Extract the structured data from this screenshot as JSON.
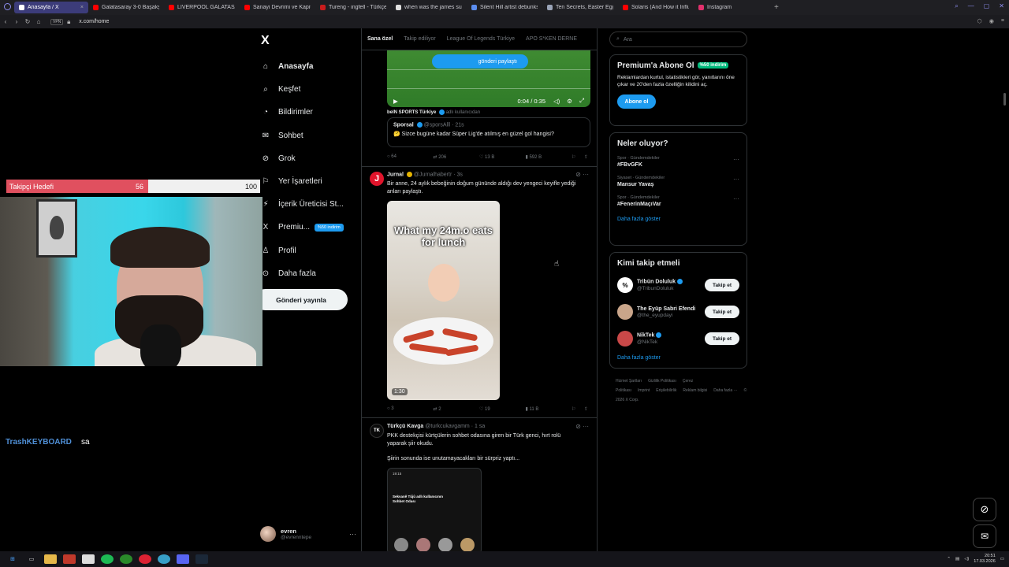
{
  "browser": {
    "tabs": [
      {
        "label": "Anasayfa / X",
        "active": true,
        "color": "#ffffff"
      },
      {
        "label": "Galatasaray 3-0 Başakşeh",
        "color": "#ff0000"
      },
      {
        "label": "LIVERPOOL GALATASARA",
        "color": "#ff0000"
      },
      {
        "label": "Sanayi Devrimi ve Kapital",
        "color": "#ff0000"
      },
      {
        "label": "Tureng - ingfell - Türkçe",
        "color": "#c91c1c"
      },
      {
        "label": "when was the james sund",
        "color": "#e0e0e0"
      },
      {
        "label": "Silent Hill artist debunks",
        "color": "#5b8def"
      },
      {
        "label": "Ten Secrets, Easter Eggs",
        "color": "#9aa4b8"
      },
      {
        "label": "Solaris (And How it Influe",
        "color": "#ff0000"
      },
      {
        "label": "Instagram",
        "color": "#e1306c"
      }
    ],
    "new_tab": "+",
    "vpn": "VPN",
    "url": "x.com/home"
  },
  "nav": {
    "logo": "X",
    "items": [
      {
        "label": "Anasayfa",
        "icon": "home-icon",
        "glyph": "⌂"
      },
      {
        "label": "Keşfet",
        "icon": "search-icon",
        "glyph": "⌕"
      },
      {
        "label": "Bildirimler",
        "icon": "bell-icon",
        "glyph": "◔"
      },
      {
        "label": "Sohbet",
        "icon": "mail-icon",
        "glyph": "✉"
      },
      {
        "label": "Grok",
        "icon": "grok-icon",
        "glyph": "⊘"
      },
      {
        "label": "Yer İşaretleri",
        "icon": "bookmark-icon",
        "glyph": "⚐"
      },
      {
        "label": "İçerik Üreticisi St...",
        "icon": "creator-studio-icon",
        "glyph": "⚡"
      },
      {
        "label": "Premiu...",
        "icon": "x-premium-icon",
        "glyph": "X",
        "badge": "%50 indirim"
      },
      {
        "label": "Profil",
        "icon": "profile-icon",
        "glyph": "♙"
      },
      {
        "label": "Daha fazla",
        "icon": "more-circle-icon",
        "glyph": "⊙"
      }
    ],
    "post_button": "Gönderi yayınla",
    "account": {
      "name": "evren",
      "handle": "@evrenntepe",
      "more": "···"
    }
  },
  "overlay": {
    "goal": {
      "label": "Takipçi Hedefi",
      "current": 56,
      "target": 100,
      "fill_color": "#e0505f"
    },
    "chat": {
      "user": "TrashKEYBOARD",
      "message": "sa"
    }
  },
  "timeline": {
    "tabs": [
      "Sana özel",
      "Takip ediliyor",
      "League Of Legends Türkiye",
      "APO S*KEN DERNE"
    ],
    "posts": [
      {
        "video": {
          "share_label": "gönderi paylaştı",
          "time": "0:04 / 0:35"
        },
        "retweet_author": "beIN SPORTS Türkiye",
        "retweet_suffix": "adlı kullanıcıdan",
        "quote": {
          "name": "Sporsal",
          "handle": "@sporsAlll · 21s",
          "text": "🤔 Sizce bugüne kadar Süper Lig'de atılmış en güzel gol hangisi?"
        },
        "stats": {
          "replies": "64",
          "reposts": "206",
          "likes": "13 B",
          "views": "592 B"
        }
      },
      {
        "avatar_letter": "J",
        "name": "Jurnal",
        "handle": "@Jurnalhabertr · 3s",
        "text": "Bir anne, 24 aylık bebeğinin doğum gününde aldığı dev yengeci keyifle yediği anları paylaştı.",
        "video": {
          "caption": "What my 24m.o eats for lunch",
          "duration": "1:30"
        },
        "stats": {
          "replies": "3",
          "reposts": "2",
          "likes": "19",
          "views": "11 B"
        }
      },
      {
        "avatar_letter": "TK",
        "name": "Türkçü Kavga",
        "handle": "@turkcukavgamm · 1 sa",
        "text": "PKK destekçisi kürtçülerin sohbet odasına giren bir Türk genci, hırt rolü yaparak şiir okudu.",
        "text2": "Şiirin sonunda ise unutamayacakları bir sürpriz yaptı...",
        "screen": {
          "clock": "19:15",
          "title": "Sekvanê Tûjû adlı kullanıcının Sohbet Odası"
        }
      }
    ]
  },
  "right": {
    "search_placeholder": "Ara",
    "premium": {
      "title": "Premium'a Abone Ol",
      "badge": "%50 indirim",
      "text": "Reklamlardan kurtul, istatistikleri gör, yanıtlarını öne çıkar ve 20'den fazla özelliğin kilidini aç.",
      "button": "Abone ol"
    },
    "trends": {
      "title": "Neler oluyor?",
      "items": [
        {
          "context": "Spor · Gündemdekiler",
          "topic": "#FBvGFK"
        },
        {
          "context": "Siyaset · Gündemdekiler",
          "topic": "Mansur Yavaş"
        },
        {
          "context": "Spor · Gündemdekiler",
          "topic": "#FenerinMaçıVar"
        }
      ],
      "show_more": "Daha fazla göster"
    },
    "who_to_follow": {
      "title": "Kimi takip etmeli",
      "users": [
        {
          "name": "Tribün Doluluk",
          "handle": "@TribunDoluluk",
          "verified": true,
          "avatar": "%",
          "color": "#ffffff"
        },
        {
          "name": "The Eyüp Sabri Efendi",
          "handle": "@the_eyupdayi",
          "verified": false,
          "avatar": "",
          "color": "#c9a58a"
        },
        {
          "name": "NikTek",
          "handle": "@NikTek",
          "verified": true,
          "avatar": "",
          "color": "#c94848"
        }
      ],
      "follow_label": "Takip et",
      "show_more": "Daha fazla göster"
    },
    "footer": [
      "Hizmet Şartları",
      "Gizlilik Politikası",
      "Çerez Politikası",
      "Imprint",
      "Erişilebilirlik",
      "Reklam bilgisi",
      "Daha fazla ···",
      "© 2026 X Corp."
    ]
  },
  "taskbar": {
    "time": "20:51",
    "date": "17.03.2026"
  },
  "accent": "#1d9bf0"
}
